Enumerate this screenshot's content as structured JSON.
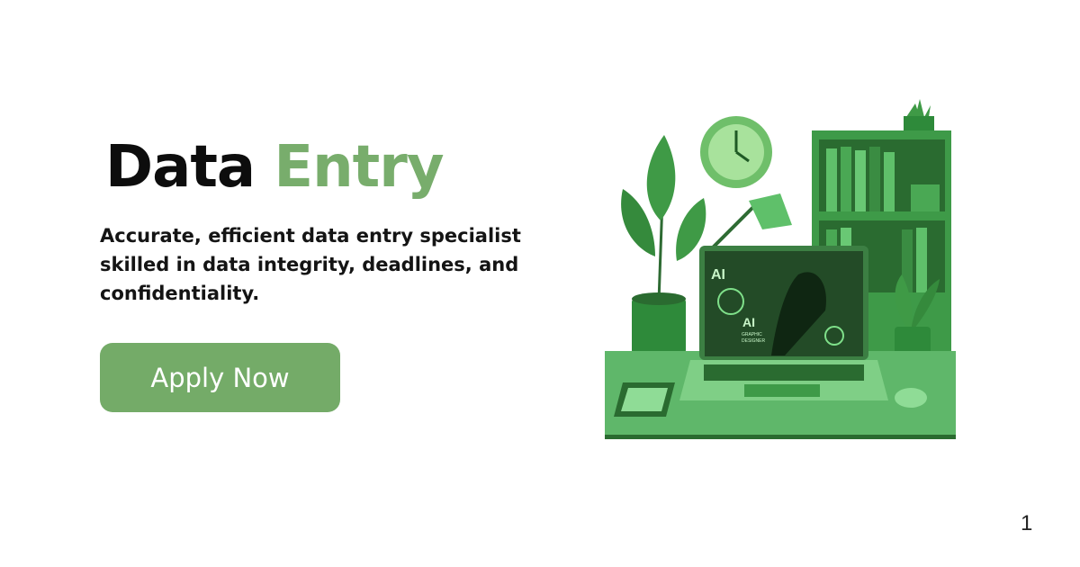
{
  "headline": {
    "word1": "Data",
    "word2": "Entry"
  },
  "description": "Accurate, efficient data entry specialist skilled in data integrity, deadlines, and confidentiality.",
  "apply_button": {
    "label": "Apply Now"
  },
  "page_number": "1",
  "colors": {
    "accent": "#78ad6c",
    "button": "#74ab68",
    "text": "#0d0d0d"
  },
  "illustration": {
    "screen_title": "AI",
    "screen_subtitle_1": "GRAPHIC",
    "screen_subtitle_2": "DESIGNER"
  }
}
